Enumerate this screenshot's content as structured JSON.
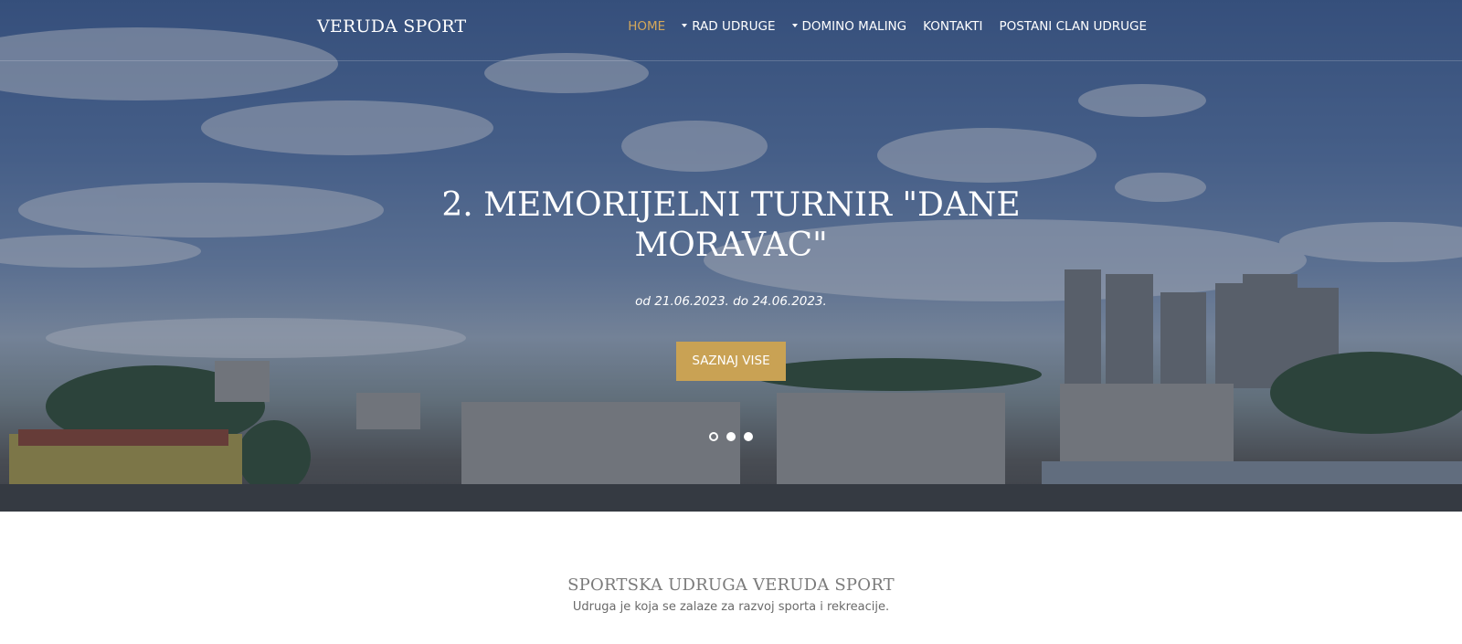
{
  "brand": "VERUDA SPORT",
  "nav": {
    "items": [
      {
        "label": "HOME",
        "active": true,
        "dropdown": false
      },
      {
        "label": "RAD UDRUGE",
        "active": false,
        "dropdown": true
      },
      {
        "label": "DOMINO MALING",
        "active": false,
        "dropdown": true
      },
      {
        "label": "KONTAKTI",
        "active": false,
        "dropdown": false
      },
      {
        "label": "POSTANI CLAN UDRUGE",
        "active": false,
        "dropdown": false
      }
    ]
  },
  "hero": {
    "title": "2. MEMORIJELNI TURNIR \"DANE MORAVAC\"",
    "subtitle": "od 21.06.2023. do 24.06.2023.",
    "button_label": "SAZNAJ VISE",
    "slides_count": 3,
    "active_slide": 1
  },
  "about": {
    "title": "SPORTSKA UDRUGA VERUDA SPORT",
    "text": "Udruga je koja se zalaze za razvoj sporta i rekreacije."
  },
  "colors": {
    "accent": "#c9a254",
    "active_nav": "#d4a85a",
    "overlay": "#14234a"
  }
}
